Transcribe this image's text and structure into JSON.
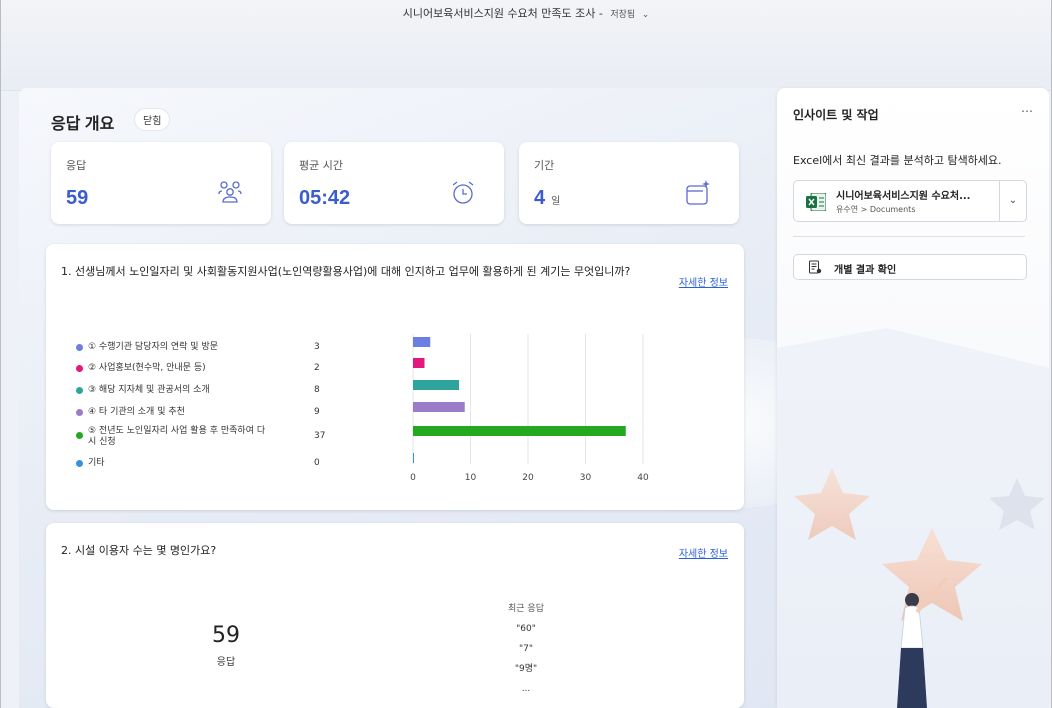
{
  "window": {
    "title": "시니어보육서비스지원 수요처 만족도 조사",
    "separator": "-",
    "saved_label": "저장됨",
    "chevron_icon": "chevron-down-icon"
  },
  "overview": {
    "title": "응답 개요",
    "close_label": "닫힘",
    "stats": [
      {
        "label": "응답",
        "value": "59",
        "unit": "",
        "icon": "people-icon"
      },
      {
        "label": "평균 시간",
        "value": "05:42",
        "unit": "",
        "icon": "alarm-clock-icon"
      },
      {
        "label": "기간",
        "value": "4",
        "unit": "일",
        "icon": "calendar-sparkle-icon"
      }
    ]
  },
  "questions": [
    {
      "text": "1. 선생님께서 노인일자리 및 사회활동지원사업(노인역량활용사업)에 대해 인지하고 업무에 활용하게 된 계기는 무엇입니까?",
      "more_label": "자세한 정보",
      "options": [
        {
          "label": "① 수행기관 담당자의 연락 및 방문",
          "count": "3",
          "color": "#6b7fe3"
        },
        {
          "label": "② 사업홍보(현수막, 안내문 등)",
          "count": "2",
          "color": "#e3177c"
        },
        {
          "label": "③ 해당 지자체 및 관공서의 소개",
          "count": "8",
          "color": "#2fa49d"
        },
        {
          "label": "④ 타 기관의 소개 및 추천",
          "count": "9",
          "color": "#9b7cc8"
        },
        {
          "label": "⑤ 전년도 노인일자리 사업 활용 후 만족하여 다시 신청",
          "count": "37",
          "color": "#24a81e"
        },
        {
          "label": "기타",
          "count": "0",
          "color": "#3a8fd9"
        }
      ]
    },
    {
      "text": "2. 시설 이용자 수는 몇 명인가요?",
      "more_label": "자세한 정보",
      "total": "59",
      "total_label": "응답",
      "recent_header": "최근 응답",
      "recent": [
        "\"60\"",
        "\"7\"",
        "\"9명\""
      ],
      "ellipsis": "..."
    }
  ],
  "chart_data": {
    "type": "bar",
    "orientation": "horizontal",
    "categories": [
      "① 수행기관 담당자의 연락 및 방문",
      "② 사업홍보(현수막, 안내문 등)",
      "③ 해당 지자체 및 관공서의 소개",
      "④ 타 기관의 소개 및 추천",
      "⑤ 전년도 노인일자리 사업 활용 후 만족하여 다시 신청",
      "기타"
    ],
    "values": [
      3,
      2,
      8,
      9,
      37,
      0
    ],
    "colors": [
      "#6b7fe3",
      "#e3177c",
      "#2fa49d",
      "#9b7cc8",
      "#24a81e",
      "#3a8fd9"
    ],
    "xlim": [
      0,
      40
    ],
    "ticks": [
      "0",
      "10",
      "20",
      "30",
      "40"
    ],
    "grid": true
  },
  "side_panel": {
    "title": "인사이트 및 작업",
    "more_icon": "more-horizontal-icon",
    "description": "Excel에서 최신 결과를 분석하고 탐색하세요.",
    "file_name": "시니어보육서비스지원 수요처...",
    "file_path": "유수연 > Documents",
    "individual_results": "개별 결과 확인"
  }
}
